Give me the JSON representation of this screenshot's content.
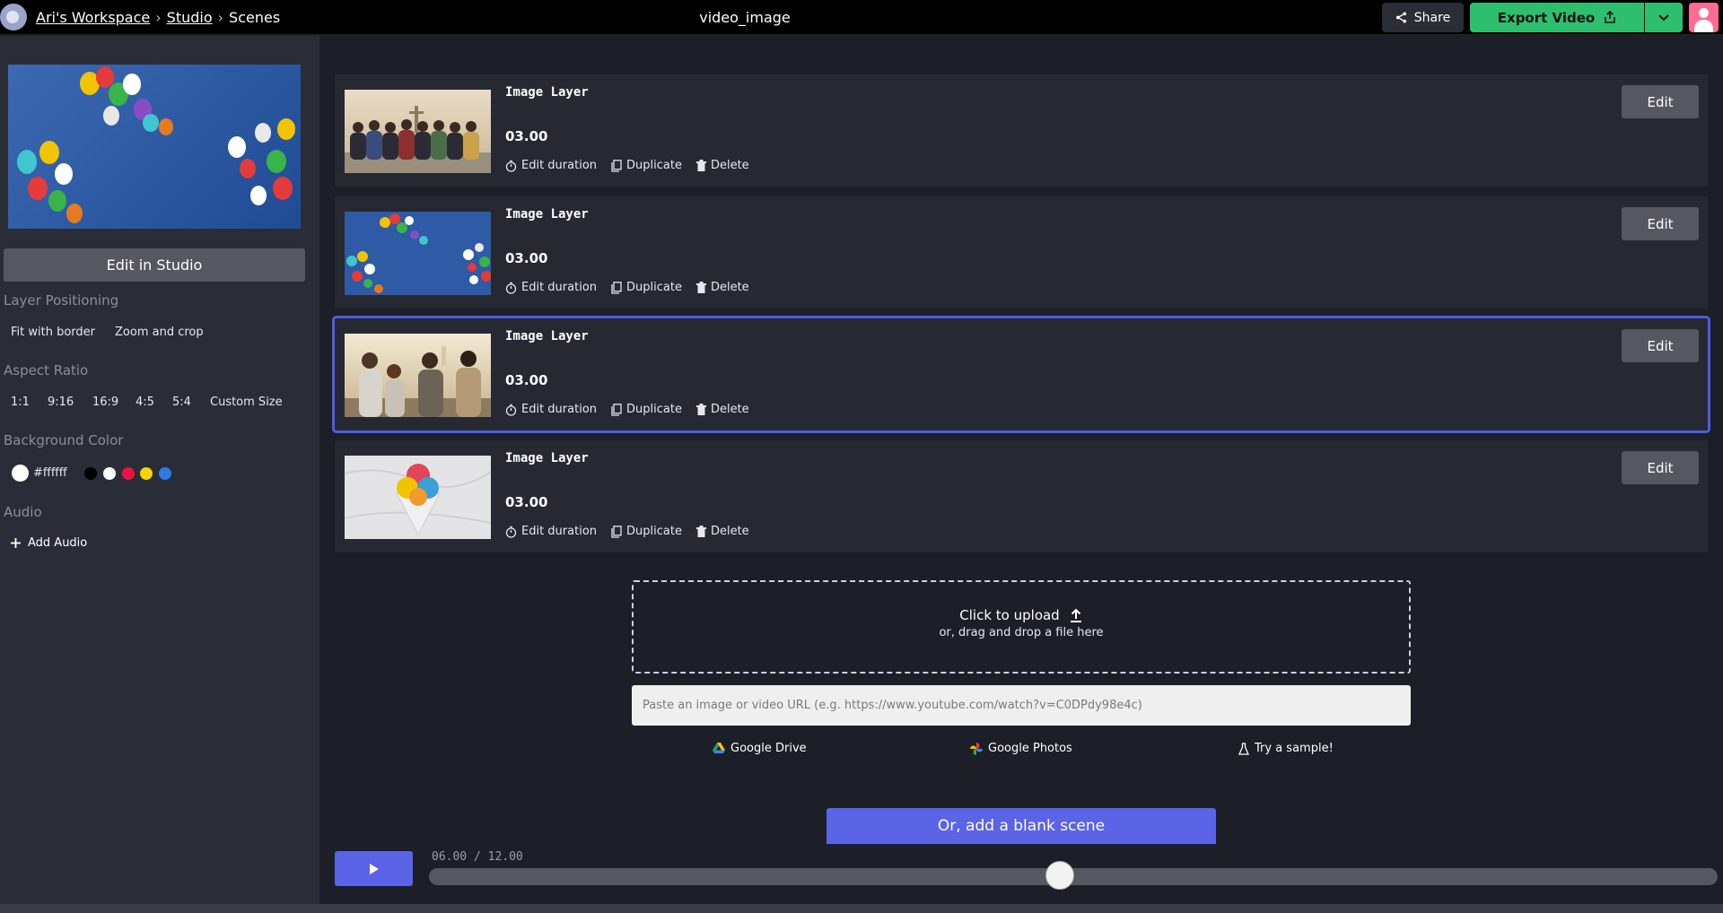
{
  "topbar": {
    "breadcrumbs": [
      "Ari's Workspace",
      "Studio",
      "Scenes"
    ],
    "separator": "›",
    "doc_title": "video_image",
    "share_label": "Share",
    "export_label": "Export Video"
  },
  "sidebar": {
    "edit_in_studio": "Edit in Studio",
    "layer_positioning": {
      "heading": "Layer Positioning",
      "options": [
        "Fit with border",
        "Zoom and crop"
      ]
    },
    "aspect_ratio": {
      "heading": "Aspect Ratio",
      "options": [
        "1:1",
        "9:16",
        "16:9",
        "4:5",
        "5:4",
        "Custom Size"
      ]
    },
    "background_color": {
      "heading": "Background Color",
      "current": "#ffffff",
      "swatches": [
        "#000000",
        "#ffffff",
        "#ee1144",
        "#f5d400",
        "#2e7be8"
      ]
    },
    "audio": {
      "heading": "Audio",
      "add_label": "Add Audio"
    }
  },
  "scenes": [
    {
      "title": "Image Layer",
      "duration": "03.00",
      "edit_duration": "Edit duration",
      "duplicate": "Duplicate",
      "delete": "Delete",
      "edit": "Edit"
    },
    {
      "title": "Image Layer",
      "duration": "03.00",
      "edit_duration": "Edit duration",
      "duplicate": "Duplicate",
      "delete": "Delete",
      "edit": "Edit"
    },
    {
      "title": "Image Layer",
      "duration": "03.00",
      "edit_duration": "Edit duration",
      "duplicate": "Duplicate",
      "delete": "Delete",
      "edit": "Edit"
    },
    {
      "title": "Image Layer",
      "duration": "03.00",
      "edit_duration": "Edit duration",
      "duplicate": "Duplicate",
      "delete": "Delete",
      "edit": "Edit"
    }
  ],
  "upload": {
    "main": "Click to upload",
    "sub": "or, drag and drop a file here",
    "url_placeholder": "Paste an image or video URL (e.g. https://www.youtube.com/watch?v=C0DPdy98e4c)",
    "google_drive": "Google Drive",
    "google_photos": "Google Photos",
    "try_sample": "Try a sample!",
    "blank_scene": "Or, add a blank scene"
  },
  "player": {
    "current_time": "06.00",
    "time_separator": "/",
    "total_time": "12.00",
    "progress": 0.5
  },
  "colors": {
    "accent": "#5b64e6",
    "export": "#2ebf6e",
    "selected_outline": "#4f5ce0"
  }
}
